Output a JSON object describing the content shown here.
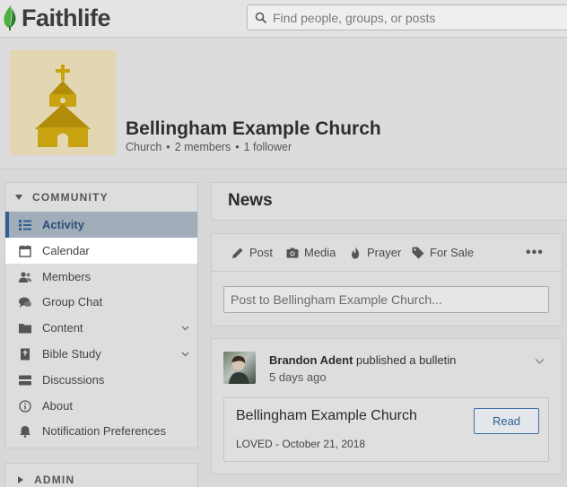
{
  "header": {
    "brand": "Faithlife",
    "search_placeholder": "Find people, groups, or posts"
  },
  "group": {
    "name": "Bellingham Example Church",
    "type": "Church",
    "members": "2 members",
    "followers": "1 follower",
    "separator": "•"
  },
  "sidebar": {
    "section_title": "COMMUNITY",
    "items": [
      {
        "label": "Activity",
        "icon": "activity-list-icon"
      },
      {
        "label": "Calendar",
        "icon": "calendar-icon"
      },
      {
        "label": "Members",
        "icon": "members-icon"
      },
      {
        "label": "Group Chat",
        "icon": "chat-icon"
      },
      {
        "label": "Content",
        "icon": "folder-icon"
      },
      {
        "label": "Bible Study",
        "icon": "bible-icon"
      },
      {
        "label": "Discussions",
        "icon": "discussions-icon"
      },
      {
        "label": "About",
        "icon": "info-icon"
      },
      {
        "label": "Notification Preferences",
        "icon": "bell-icon"
      }
    ],
    "admin_title": "ADMIN"
  },
  "main": {
    "news_title": "News",
    "composer": {
      "tabs": [
        {
          "label": "Post",
          "icon": "pencil-icon"
        },
        {
          "label": "Media",
          "icon": "camera-icon"
        },
        {
          "label": "Prayer",
          "icon": "flame-icon"
        },
        {
          "label": "For Sale",
          "icon": "tag-icon"
        }
      ],
      "more_label": "•••",
      "input_placeholder": "Post to Bellingham Example Church..."
    },
    "feed": {
      "author": "Brandon Adent",
      "action": "published a bulletin",
      "time": "5 days ago",
      "bulletin_title": "Bellingham Example Church",
      "bulletin_sub": "LOVED - October 21, 2018",
      "read_label": "Read"
    }
  },
  "colors": {
    "accent": "#2f5e95",
    "active_bg": "#a1adb8",
    "logo_green": "#3e9a3b",
    "church_gold": "#c9a20f"
  }
}
